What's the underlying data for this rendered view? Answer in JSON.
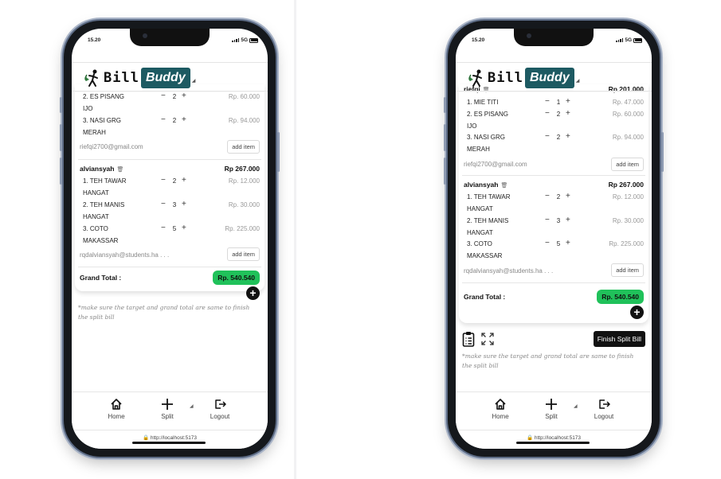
{
  "status": {
    "time": "15.20",
    "network": "5G"
  },
  "logo": {
    "bill": "Bill",
    "buddy": "Buddy"
  },
  "footer_note": "*make sure the target and grand total are same to finish the split bill",
  "nav": {
    "home": "Home",
    "split": "Split",
    "logout": "Logout"
  },
  "url": "http://localhost:5173",
  "left": {
    "partial_items": [
      {
        "name": "2. ES PISANG IJO",
        "qty": "2",
        "price": "Rp. 60.000"
      },
      {
        "name": "3. NASI GRG MERAH",
        "qty": "2",
        "price": "Rp. 94.000"
      }
    ],
    "riefqi_email": "riefqi2700@gmail.com",
    "add_item_label": "add item",
    "alviansyah": {
      "name": "alviansyah",
      "total": "Rp 267.000",
      "items": [
        {
          "name": "1. TEH TAWAR HANGAT",
          "qty": "2",
          "price": "Rp. 12.000"
        },
        {
          "name": "2. TEH MANIS HANGAT",
          "qty": "3",
          "price": "Rp. 30.000"
        },
        {
          "name": "3. COTO MAKASSAR",
          "qty": "5",
          "price": "Rp. 225.000"
        }
      ],
      "email": "rqdalviansyah@students.ha . . ."
    },
    "grand_total_label": "Grand Total :",
    "grand_total": "Rp. 540.540"
  },
  "right": {
    "riefqi": {
      "name": "riefqi",
      "total": "Rp 201.000",
      "items": [
        {
          "name": "1. MIE TITI",
          "qty": "1",
          "price": "Rp. 47.000"
        },
        {
          "name": "2. ES PISANG IJO",
          "qty": "2",
          "price": "Rp. 60.000"
        },
        {
          "name": "3. NASI GRG MERAH",
          "qty": "2",
          "price": "Rp. 94.000"
        }
      ],
      "email": "riefqi2700@gmail.com"
    },
    "add_item_label": "add item",
    "alviansyah": {
      "name": "alviansyah",
      "total": "Rp 267.000",
      "items": [
        {
          "name": "1. TEH TAWAR HANGAT",
          "qty": "2",
          "price": "Rp. 12.000"
        },
        {
          "name": "2. TEH MANIS HANGAT",
          "qty": "3",
          "price": "Rp. 30.000"
        },
        {
          "name": "3. COTO MAKASSAR",
          "qty": "5",
          "price": "Rp. 225.000"
        }
      ],
      "email": "rqdalviansyah@students.ha . . ."
    },
    "grand_total_label": "Grand Total :",
    "grand_total": "Rp. 540.540",
    "finish_label": "Finish Split Bill"
  },
  "icons": [
    "clipboard-icon",
    "expand-icon",
    "trash-icon",
    "plus-icon",
    "minus-icon",
    "home-icon",
    "logout-icon",
    "lock-icon"
  ],
  "colors": {
    "brand": "#1d5a62",
    "total_badge": "#20c15a",
    "finish_button": "#111111"
  }
}
